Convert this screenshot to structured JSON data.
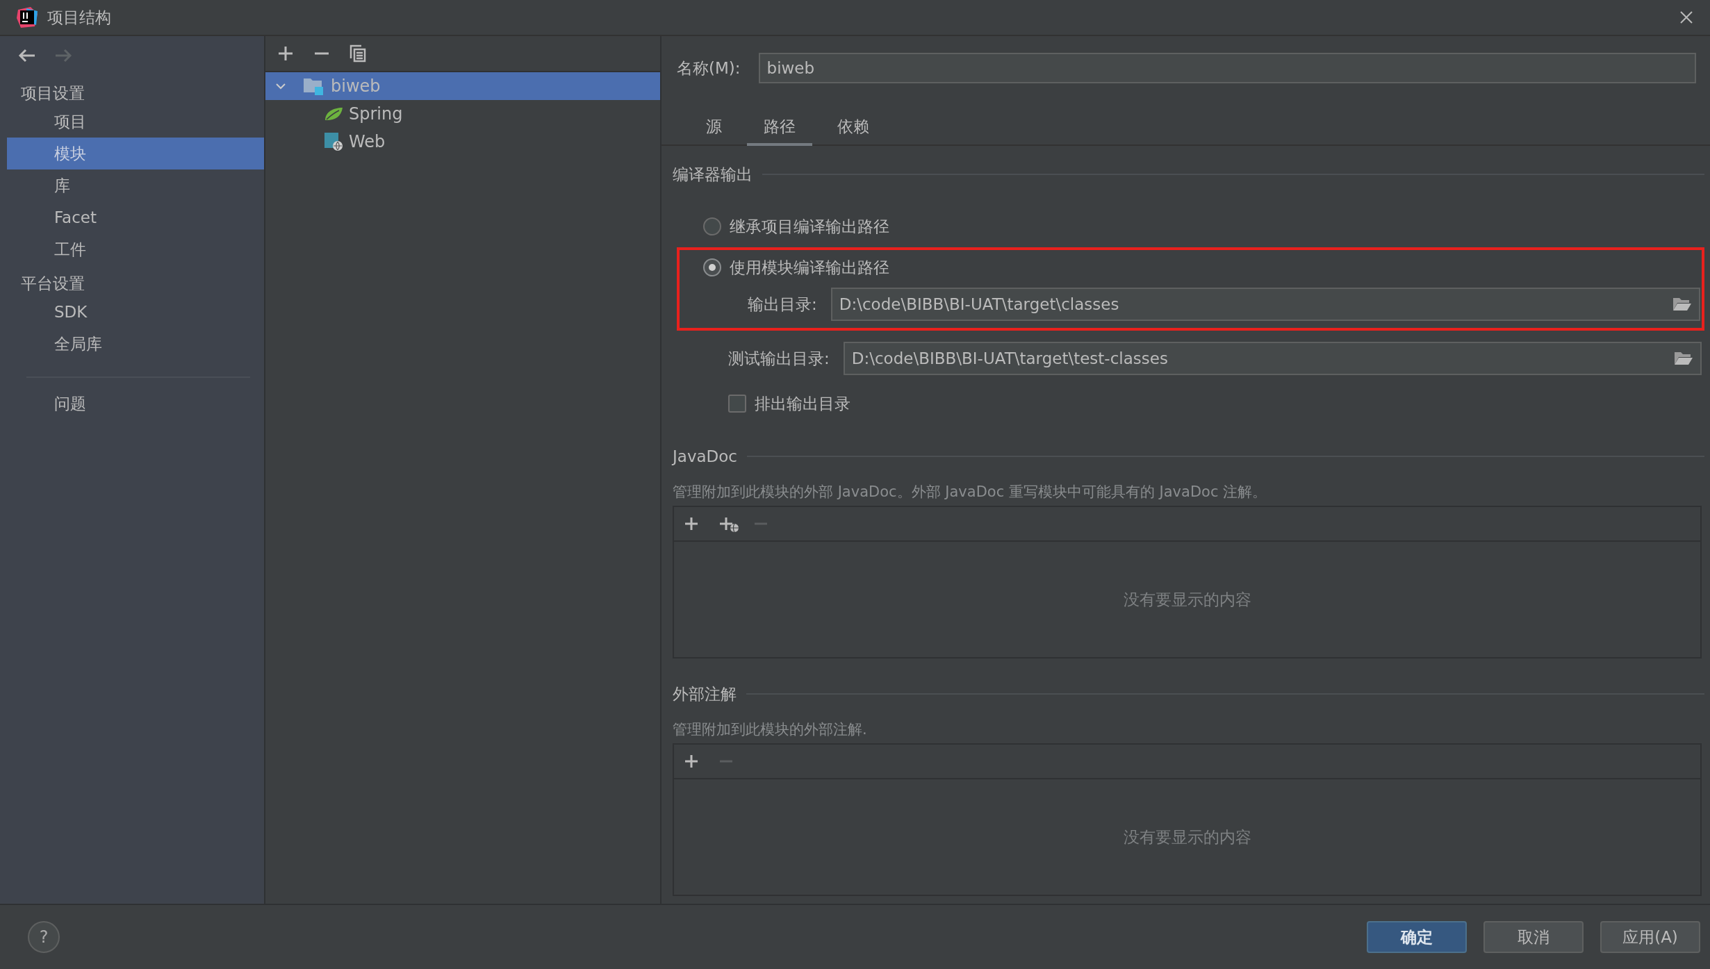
{
  "window": {
    "title": "项目结构"
  },
  "nav_buttons": [
    {
      "kind": "back",
      "disabled": false
    },
    {
      "kind": "forward",
      "disabled": true
    }
  ],
  "sidebar": {
    "sections": [
      {
        "heading": "项目设置",
        "items": [
          {
            "label": "项目",
            "selected": false
          },
          {
            "label": "模块",
            "selected": true
          },
          {
            "label": "库",
            "selected": false
          },
          {
            "label": "Facet",
            "selected": false
          },
          {
            "label": "工件",
            "selected": false
          }
        ]
      },
      {
        "heading": "平台设置",
        "items": [
          {
            "label": "SDK",
            "selected": false
          },
          {
            "label": "全局库",
            "selected": false
          }
        ]
      }
    ],
    "extra_items": [
      {
        "label": "问题",
        "selected": false
      }
    ]
  },
  "tree": {
    "toolbar": [
      {
        "kind": "add"
      },
      {
        "kind": "remove"
      },
      {
        "kind": "copy"
      }
    ],
    "items": [
      {
        "label": "biweb",
        "kind": "module",
        "expanded": true,
        "selected": true,
        "children": [
          {
            "label": "Spring",
            "kind": "spring",
            "selected": false
          },
          {
            "label": "Web",
            "kind": "web",
            "selected": false
          }
        ]
      }
    ]
  },
  "details": {
    "name_label": "名称(M):",
    "name_value": "biweb",
    "tabs": [
      {
        "label": "源",
        "selected": false
      },
      {
        "label": "路径",
        "selected": true
      },
      {
        "label": "依赖",
        "selected": false
      }
    ],
    "compiler_output": {
      "title": "编译器输出",
      "options": [
        {
          "label": "继承项目编译输出路径",
          "selected": false
        },
        {
          "label": "使用模块编译输出路径",
          "selected": true
        }
      ],
      "output_dir": {
        "label": "输出目录:",
        "value": "D:\\code\\BIBB\\BI-UAT\\target\\classes"
      },
      "test_output_dir": {
        "label": "测试输出目录:",
        "value": "D:\\code\\BIBB\\BI-UAT\\target\\test-classes"
      },
      "exclude": {
        "label": "排出输出目录",
        "checked": false
      }
    },
    "lists": [
      {
        "title": "JavaDoc",
        "description": "管理附加到此模块的外部 JavaDoc。外部 JavaDoc 重写模块中可能具有的 JavaDoc 注解。",
        "toolbar": [
          {
            "kind": "add",
            "disabled": false
          },
          {
            "kind": "add-url",
            "disabled": false
          },
          {
            "kind": "remove",
            "disabled": true
          }
        ],
        "empty_text": "没有要显示的内容"
      },
      {
        "title": "外部注解",
        "description": "管理附加到此模块的外部注解.",
        "toolbar": [
          {
            "kind": "add",
            "disabled": false
          },
          {
            "kind": "remove",
            "disabled": true
          }
        ],
        "empty_text": "没有要显示的内容"
      }
    ]
  },
  "footer": {
    "help": "?",
    "buttons": [
      {
        "label": "确定",
        "kind": "primary"
      },
      {
        "label": "取消",
        "kind": "normal"
      },
      {
        "label": "应用(A)",
        "kind": "normal"
      }
    ]
  }
}
